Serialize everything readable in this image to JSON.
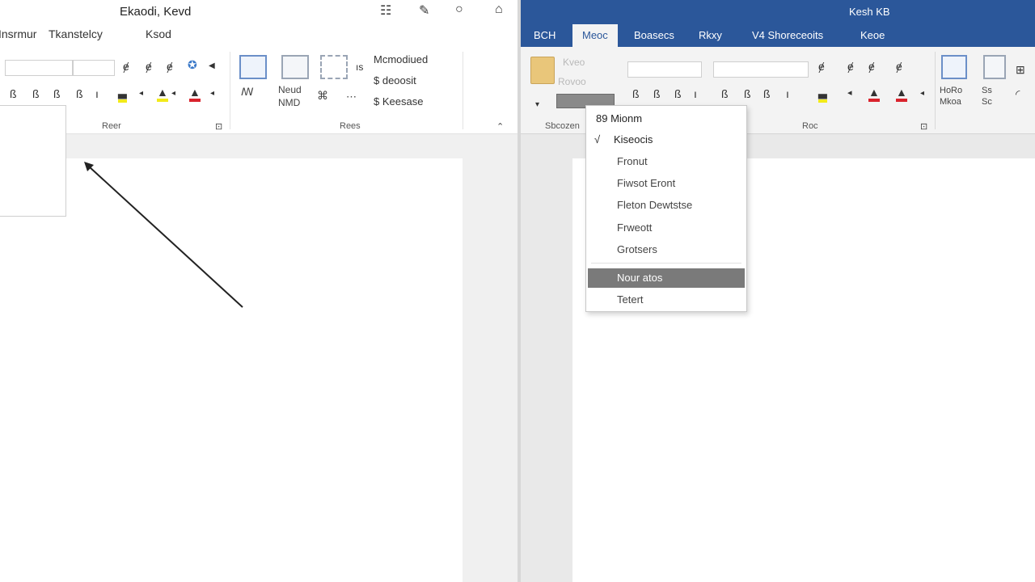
{
  "left_window": {
    "title": "Ekaodi, Kevd",
    "tabs": [
      "Insrmur",
      "Tkanstelcy",
      "Ksod"
    ],
    "ribbon": {
      "menu_items": [
        "Mcmodiued",
        "$ deoosit",
        "$ Keesase"
      ],
      "big_labels": [
        "Neud",
        "NMD"
      ],
      "group_labels": [
        "Reer",
        "Rees"
      ]
    }
  },
  "right_window": {
    "title": "Kesh KB",
    "tabs": [
      "BCH",
      "Meoc",
      "Boasecs",
      "Rkxy",
      "V4 Shoreceoits",
      "Keoe"
    ],
    "ribbon": {
      "faded_labels": [
        "Kveo",
        "Rovoo"
      ],
      "group_labels": [
        "Sbcozen",
        "Roc"
      ],
      "right_labels": [
        "HoRo",
        "Mkoa",
        "Ss",
        "Sc"
      ]
    },
    "dropdown": {
      "items": [
        "89 Mionm",
        "Kiseocis",
        "Fronut",
        "Fiwsot Eront",
        "Fleton Dewtstse",
        "Frweott",
        "Grotsers"
      ],
      "highlighted": "Nour atos",
      "footer": "Tetert"
    }
  },
  "colors": {
    "title_blue": "#2b579a",
    "highlight_yellow": "#f2ea1a",
    "highlight_red": "#d9232d",
    "menu_hover": "#7a7a7a"
  }
}
